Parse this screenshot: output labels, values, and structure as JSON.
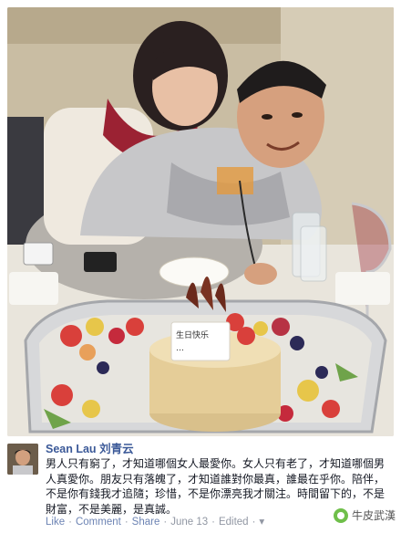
{
  "photo": {
    "cake_card_lines": [
      "生日快乐",
      "…"
    ]
  },
  "post": {
    "author_en": "Sean Lau",
    "author_cn": "刘青云",
    "body": "男人只有窮了，才知道哪個女人最愛你。女人只有老了，才知道哪個男人真愛你。朋友只有落魄了，才知道誰對你最真，誰最在乎你。陪伴，不是你有錢我才追隨；珍惜，不是你漂亮我才關注。時間留下的，不是財富，不是美麗，是真誠。",
    "actions": {
      "like": "Like",
      "comment": "Comment",
      "share": "Share",
      "date": "June 13",
      "edited": "Edited",
      "separator": "·",
      "more_icon": "chevron-down"
    }
  },
  "watermark": {
    "text": "牛皮武漢",
    "icon": "wechat-style-circle-icon"
  }
}
